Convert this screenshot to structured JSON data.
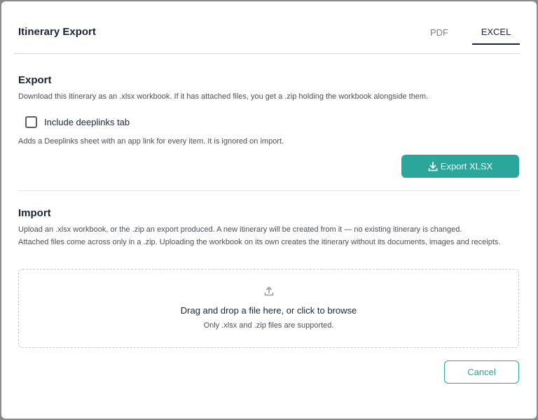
{
  "dialog": {
    "title": "Itinerary Export",
    "tabs": [
      {
        "label": "PDF",
        "active": false
      },
      {
        "label": "EXCEL",
        "active": true
      }
    ]
  },
  "export": {
    "heading": "Export",
    "description": "Download this itinerary as an .xlsx workbook. If it has attached files, you get a .zip holding the workbook alongside them.",
    "checkbox_label": "Include deeplinks tab",
    "checkbox_checked": false,
    "checkbox_help": "Adds a Deeplinks sheet with an app link for every item. It is ignored on import.",
    "button_label": "Export XLSX",
    "button_icon": "download-icon"
  },
  "import": {
    "heading": "Import",
    "description_1": "Upload an .xlsx workbook, or the .zip an export produced. A new itinerary will be created from it — no existing itinerary is changed.",
    "description_2": "Attached files come across only in a .zip. Uploading the workbook on its own creates the itinerary without its documents, images and receipts.",
    "dropzone_icon": "upload-icon",
    "dropzone_text": "Drag and drop a file here, or click to browse",
    "dropzone_subtext": "Only .xlsx and .zip files are supported."
  },
  "footer": {
    "cancel_label": "Cancel"
  },
  "colors": {
    "accent": "#2ba69a",
    "text_primary": "#1b2436",
    "overlay": "#8a8a8a"
  }
}
